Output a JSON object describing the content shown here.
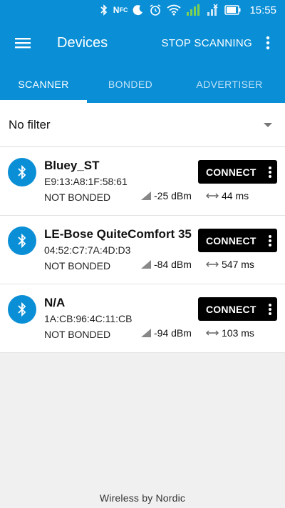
{
  "status_bar": {
    "time": "15:55",
    "icons": [
      "bluetooth-icon",
      "nfc-icon",
      "moon-icon",
      "alarm-icon",
      "wifi-icon",
      "signal-icon",
      "no-signal-icon",
      "battery-icon"
    ]
  },
  "app_bar": {
    "title": "Devices",
    "stop_label": "STOP SCANNING"
  },
  "tabs": [
    {
      "label": "SCANNER",
      "active": true
    },
    {
      "label": "BONDED",
      "active": false
    },
    {
      "label": "ADVERTISER",
      "active": false
    }
  ],
  "filter": {
    "label": "No filter"
  },
  "devices": [
    {
      "name": "Bluey_ST",
      "address": "E9:13:A8:1F:58:61",
      "bond": "NOT BONDED",
      "rssi": "-25 dBm",
      "interval": "44 ms",
      "connect_label": "CONNECT"
    },
    {
      "name": "LE-Bose QuiteComfort 35",
      "address": "04:52:C7:7A:4D:D3",
      "bond": "NOT BONDED",
      "rssi": "-84 dBm",
      "interval": "547 ms",
      "connect_label": "CONNECT"
    },
    {
      "name": "N/A",
      "address": "1A:CB:96:4C:11:CB",
      "bond": "NOT BONDED",
      "rssi": "-94 dBm",
      "interval": "103 ms",
      "connect_label": "CONNECT"
    }
  ],
  "footer": {
    "text": "Wireless by Nordic"
  },
  "colors": {
    "accent": "#0a8fd7",
    "button": "#000000",
    "background": "#f0f0f0"
  }
}
